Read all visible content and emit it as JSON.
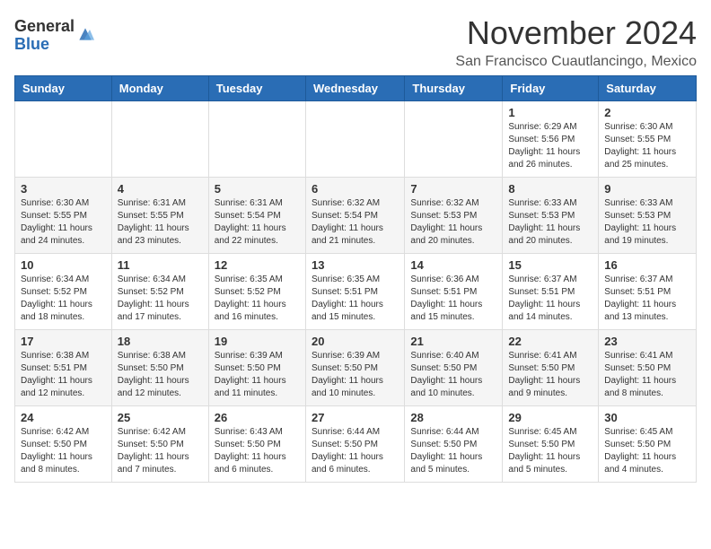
{
  "header": {
    "logo_general": "General",
    "logo_blue": "Blue",
    "month_title": "November 2024",
    "subtitle": "San Francisco Cuautlancingo, Mexico"
  },
  "days_of_week": [
    "Sunday",
    "Monday",
    "Tuesday",
    "Wednesday",
    "Thursday",
    "Friday",
    "Saturday"
  ],
  "weeks": [
    [
      {
        "day": "",
        "info": ""
      },
      {
        "day": "",
        "info": ""
      },
      {
        "day": "",
        "info": ""
      },
      {
        "day": "",
        "info": ""
      },
      {
        "day": "",
        "info": ""
      },
      {
        "day": "1",
        "info": "Sunrise: 6:29 AM\nSunset: 5:56 PM\nDaylight: 11 hours\nand 26 minutes."
      },
      {
        "day": "2",
        "info": "Sunrise: 6:30 AM\nSunset: 5:55 PM\nDaylight: 11 hours\nand 25 minutes."
      }
    ],
    [
      {
        "day": "3",
        "info": "Sunrise: 6:30 AM\nSunset: 5:55 PM\nDaylight: 11 hours\nand 24 minutes."
      },
      {
        "day": "4",
        "info": "Sunrise: 6:31 AM\nSunset: 5:55 PM\nDaylight: 11 hours\nand 23 minutes."
      },
      {
        "day": "5",
        "info": "Sunrise: 6:31 AM\nSunset: 5:54 PM\nDaylight: 11 hours\nand 22 minutes."
      },
      {
        "day": "6",
        "info": "Sunrise: 6:32 AM\nSunset: 5:54 PM\nDaylight: 11 hours\nand 21 minutes."
      },
      {
        "day": "7",
        "info": "Sunrise: 6:32 AM\nSunset: 5:53 PM\nDaylight: 11 hours\nand 20 minutes."
      },
      {
        "day": "8",
        "info": "Sunrise: 6:33 AM\nSunset: 5:53 PM\nDaylight: 11 hours\nand 20 minutes."
      },
      {
        "day": "9",
        "info": "Sunrise: 6:33 AM\nSunset: 5:53 PM\nDaylight: 11 hours\nand 19 minutes."
      }
    ],
    [
      {
        "day": "10",
        "info": "Sunrise: 6:34 AM\nSunset: 5:52 PM\nDaylight: 11 hours\nand 18 minutes."
      },
      {
        "day": "11",
        "info": "Sunrise: 6:34 AM\nSunset: 5:52 PM\nDaylight: 11 hours\nand 17 minutes."
      },
      {
        "day": "12",
        "info": "Sunrise: 6:35 AM\nSunset: 5:52 PM\nDaylight: 11 hours\nand 16 minutes."
      },
      {
        "day": "13",
        "info": "Sunrise: 6:35 AM\nSunset: 5:51 PM\nDaylight: 11 hours\nand 15 minutes."
      },
      {
        "day": "14",
        "info": "Sunrise: 6:36 AM\nSunset: 5:51 PM\nDaylight: 11 hours\nand 15 minutes."
      },
      {
        "day": "15",
        "info": "Sunrise: 6:37 AM\nSunset: 5:51 PM\nDaylight: 11 hours\nand 14 minutes."
      },
      {
        "day": "16",
        "info": "Sunrise: 6:37 AM\nSunset: 5:51 PM\nDaylight: 11 hours\nand 13 minutes."
      }
    ],
    [
      {
        "day": "17",
        "info": "Sunrise: 6:38 AM\nSunset: 5:51 PM\nDaylight: 11 hours\nand 12 minutes."
      },
      {
        "day": "18",
        "info": "Sunrise: 6:38 AM\nSunset: 5:50 PM\nDaylight: 11 hours\nand 12 minutes."
      },
      {
        "day": "19",
        "info": "Sunrise: 6:39 AM\nSunset: 5:50 PM\nDaylight: 11 hours\nand 11 minutes."
      },
      {
        "day": "20",
        "info": "Sunrise: 6:39 AM\nSunset: 5:50 PM\nDaylight: 11 hours\nand 10 minutes."
      },
      {
        "day": "21",
        "info": "Sunrise: 6:40 AM\nSunset: 5:50 PM\nDaylight: 11 hours\nand 10 minutes."
      },
      {
        "day": "22",
        "info": "Sunrise: 6:41 AM\nSunset: 5:50 PM\nDaylight: 11 hours\nand 9 minutes."
      },
      {
        "day": "23",
        "info": "Sunrise: 6:41 AM\nSunset: 5:50 PM\nDaylight: 11 hours\nand 8 minutes."
      }
    ],
    [
      {
        "day": "24",
        "info": "Sunrise: 6:42 AM\nSunset: 5:50 PM\nDaylight: 11 hours\nand 8 minutes."
      },
      {
        "day": "25",
        "info": "Sunrise: 6:42 AM\nSunset: 5:50 PM\nDaylight: 11 hours\nand 7 minutes."
      },
      {
        "day": "26",
        "info": "Sunrise: 6:43 AM\nSunset: 5:50 PM\nDaylight: 11 hours\nand 6 minutes."
      },
      {
        "day": "27",
        "info": "Sunrise: 6:44 AM\nSunset: 5:50 PM\nDaylight: 11 hours\nand 6 minutes."
      },
      {
        "day": "28",
        "info": "Sunrise: 6:44 AM\nSunset: 5:50 PM\nDaylight: 11 hours\nand 5 minutes."
      },
      {
        "day": "29",
        "info": "Sunrise: 6:45 AM\nSunset: 5:50 PM\nDaylight: 11 hours\nand 5 minutes."
      },
      {
        "day": "30",
        "info": "Sunrise: 6:45 AM\nSunset: 5:50 PM\nDaylight: 11 hours\nand 4 minutes."
      }
    ]
  ]
}
